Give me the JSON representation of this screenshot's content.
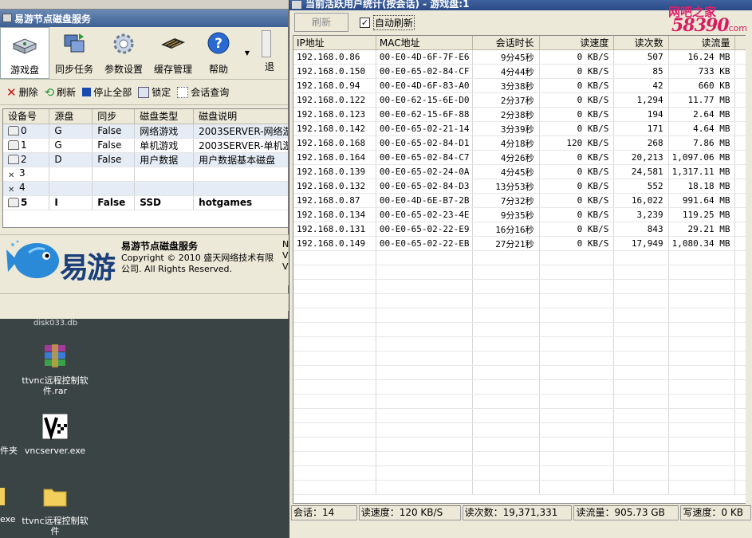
{
  "left_window": {
    "title": "易游节点磁盘服务",
    "toolbar": [
      {
        "label": "游戏盘",
        "icon": "disk-icon",
        "active": true
      },
      {
        "label": "同步任务",
        "icon": "sync-icon"
      },
      {
        "label": "参数设置",
        "icon": "gear-icon"
      },
      {
        "label": "缓存管理",
        "icon": "memory-icon"
      },
      {
        "label": "帮助",
        "icon": "help-icon"
      },
      {
        "label": "退",
        "icon": "exit-icon"
      }
    ],
    "actions": {
      "delete": "删除",
      "refresh": "刷新",
      "stop_all": "停止全部",
      "lock": "锁定",
      "session_query": "会话查询"
    },
    "disk_table": {
      "headers": [
        "设备号",
        "源盘",
        "同步",
        "磁盘类型",
        "磁盘说明"
      ],
      "rows": [
        [
          "0",
          "G",
          "False",
          "网络游戏",
          "2003SERVER-网络游"
        ],
        [
          "1",
          "G",
          "False",
          "单机游戏",
          "2003SERVER-单机游"
        ],
        [
          "2",
          "D",
          "False",
          "用户数据",
          "用户数据基本磁盘"
        ],
        [
          "3",
          "",
          "",
          "",
          ""
        ],
        [
          "4",
          "",
          "",
          "",
          ""
        ],
        [
          "5",
          "I",
          "False",
          "SSD",
          "hotgames"
        ]
      ]
    },
    "about": {
      "brand": "易游",
      "name": "易游节点磁盘服务",
      "copyright": "Copyright © 2010 盛天网络技术有限公司. All Rights Reserved.",
      "cut_text": "N\nV\nV"
    }
  },
  "desktop": {
    "icons": [
      {
        "label": "ttvnc远程控制软件.rar",
        "icon": "winrar-archive-icon"
      },
      {
        "label": "vncserver.exe",
        "icon": "vnc-exe-icon"
      },
      {
        "label": "ttvnc远程控制软件",
        "icon": "folder-icon"
      }
    ],
    "cut_top": "disk033.db",
    "cut_left_1": "件夹",
    "cut_left_2": "exe"
  },
  "right_window": {
    "title": "当前活跃用户统计(按会话) - 游戏盘:1",
    "refresh_label": "刷新",
    "auto_refresh_label": "自动刷新",
    "auto_refresh_checked": true,
    "columns": [
      "IP地址",
      "MAC地址",
      "会话时长",
      "读速度",
      "读次数",
      "读流量"
    ],
    "rows": [
      [
        "192.168.0.86",
        "00-E0-4D-6F-7F-E6",
        "9分45秒",
        "0 KB/S",
        "507",
        "16.24 MB"
      ],
      [
        "192.168.0.150",
        "00-E0-65-02-84-CF",
        "4分44秒",
        "0 KB/S",
        "85",
        "733 KB"
      ],
      [
        "192.168.0.94",
        "00-E0-4D-6F-83-A0",
        "3分38秒",
        "0 KB/S",
        "42",
        "660 KB"
      ],
      [
        "192.168.0.122",
        "00-E0-62-15-6E-D0",
        "2分37秒",
        "0 KB/S",
        "1,294",
        "11.77 MB"
      ],
      [
        "192.168.0.123",
        "00-E0-62-15-6F-88",
        "2分38秒",
        "0 KB/S",
        "194",
        "2.64 MB"
      ],
      [
        "192.168.0.142",
        "00-E0-65-02-21-14",
        "3分39秒",
        "0 KB/S",
        "171",
        "4.64 MB"
      ],
      [
        "192.168.0.168",
        "00-E0-65-02-84-D1",
        "4分18秒",
        "120 KB/S",
        "268",
        "7.86 MB"
      ],
      [
        "192.168.0.164",
        "00-E0-65-02-84-C7",
        "4分26秒",
        "0 KB/S",
        "20,213",
        "1,097.06 MB"
      ],
      [
        "192.168.0.139",
        "00-E0-65-02-24-0A",
        "4分45秒",
        "0 KB/S",
        "24,581",
        "1,317.11 MB"
      ],
      [
        "192.168.0.132",
        "00-E0-65-02-84-D3",
        "13分53秒",
        "0 KB/S",
        "552",
        "18.18 MB"
      ],
      [
        "192.168.0.87",
        "00-E0-4D-6E-B7-2B",
        "7分32秒",
        "0 KB/S",
        "16,022",
        "991.64 MB"
      ],
      [
        "192.168.0.134",
        "00-E0-65-02-23-4E",
        "9分35秒",
        "0 KB/S",
        "3,239",
        "119.25 MB"
      ],
      [
        "192.168.0.131",
        "00-E0-65-02-22-E9",
        "16分16秒",
        "0 KB/S",
        "843",
        "29.21 MB"
      ],
      [
        "192.168.0.149",
        "00-E0-65-02-22-EB",
        "27分21秒",
        "0 KB/S",
        "17,949",
        "1,080.34 MB"
      ]
    ],
    "status": {
      "sessions": "会话：14",
      "read_speed": "读速度：120 KB/S",
      "read_count": "读次数：19,371,331",
      "read_volume": "读流量：905.73 GB",
      "write_speed": "写速度：0 KB"
    }
  },
  "watermark": {
    "top": "网吧之家",
    "num": "58390",
    "com": ".com"
  }
}
